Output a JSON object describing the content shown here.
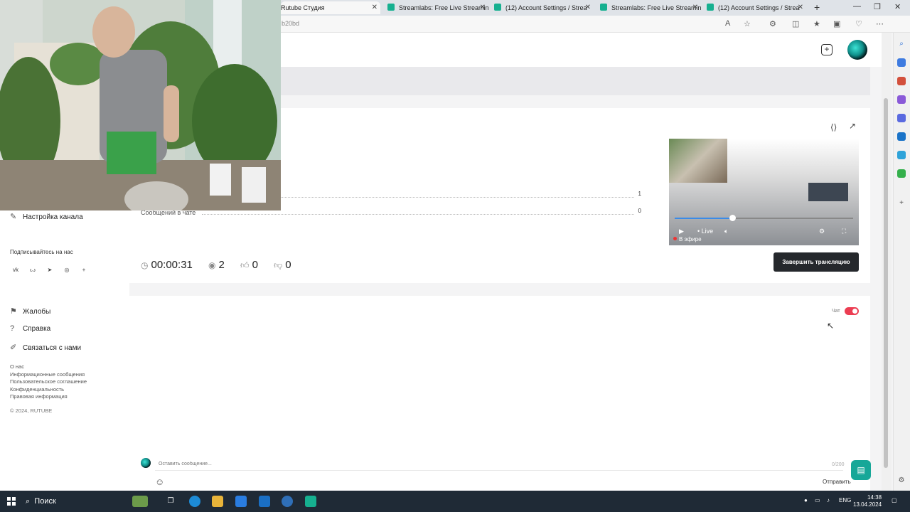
{
  "browser": {
    "tabs": [
      {
        "title": "Rutube Студия",
        "active": true
      },
      {
        "title": "Streamlabs: Free Live Streamin"
      },
      {
        "title": "(12) Account Settings / Strea"
      },
      {
        "title": "Streamlabs: Free Live Streamin"
      },
      {
        "title": "(12) Account Settings / Strea"
      }
    ],
    "url_fragment": "b20bd"
  },
  "sidebar": {
    "channel_settings": "Настройка канала",
    "subscribe_heading": "Подписывайтесь на нас",
    "social_icons": [
      "vk-icon",
      "ok-icon",
      "telegram-icon",
      "viber-icon",
      "plus-icon"
    ],
    "complaints": "Жалобы",
    "help": "Справка",
    "contact": "Связаться с нами",
    "footer_links": [
      "О нас",
      "Информационные сообщения",
      "Пользовательское соглашение",
      "Конфиденциальность",
      "Правовая информация"
    ],
    "copyright": "© 2024, RUTUBE"
  },
  "broadcast": {
    "stats": [
      {
        "label": "",
        "value": "1"
      },
      {
        "label": "Сообщений в чате",
        "value": "0"
      }
    ],
    "duration": "00:00:31",
    "viewers": "2",
    "likes": "0",
    "dislikes": "0",
    "end_button": "Завершить трансляцию",
    "player": {
      "live_label": "Live",
      "on_air_label": "В эфире"
    }
  },
  "chat": {
    "label": "Чат",
    "enabled": true,
    "input_placeholder": "Оставить сообщение...",
    "char_counter": "0/200",
    "send_button": "Отправить"
  },
  "taskbar": {
    "search_label": "Поиск",
    "language": "ENG",
    "time": "14:38",
    "date": "13.04.2024"
  },
  "colors": {
    "toggle_on": "#ec3d52",
    "accent_teal": "#17a798",
    "end_button_bg": "#25282c"
  }
}
